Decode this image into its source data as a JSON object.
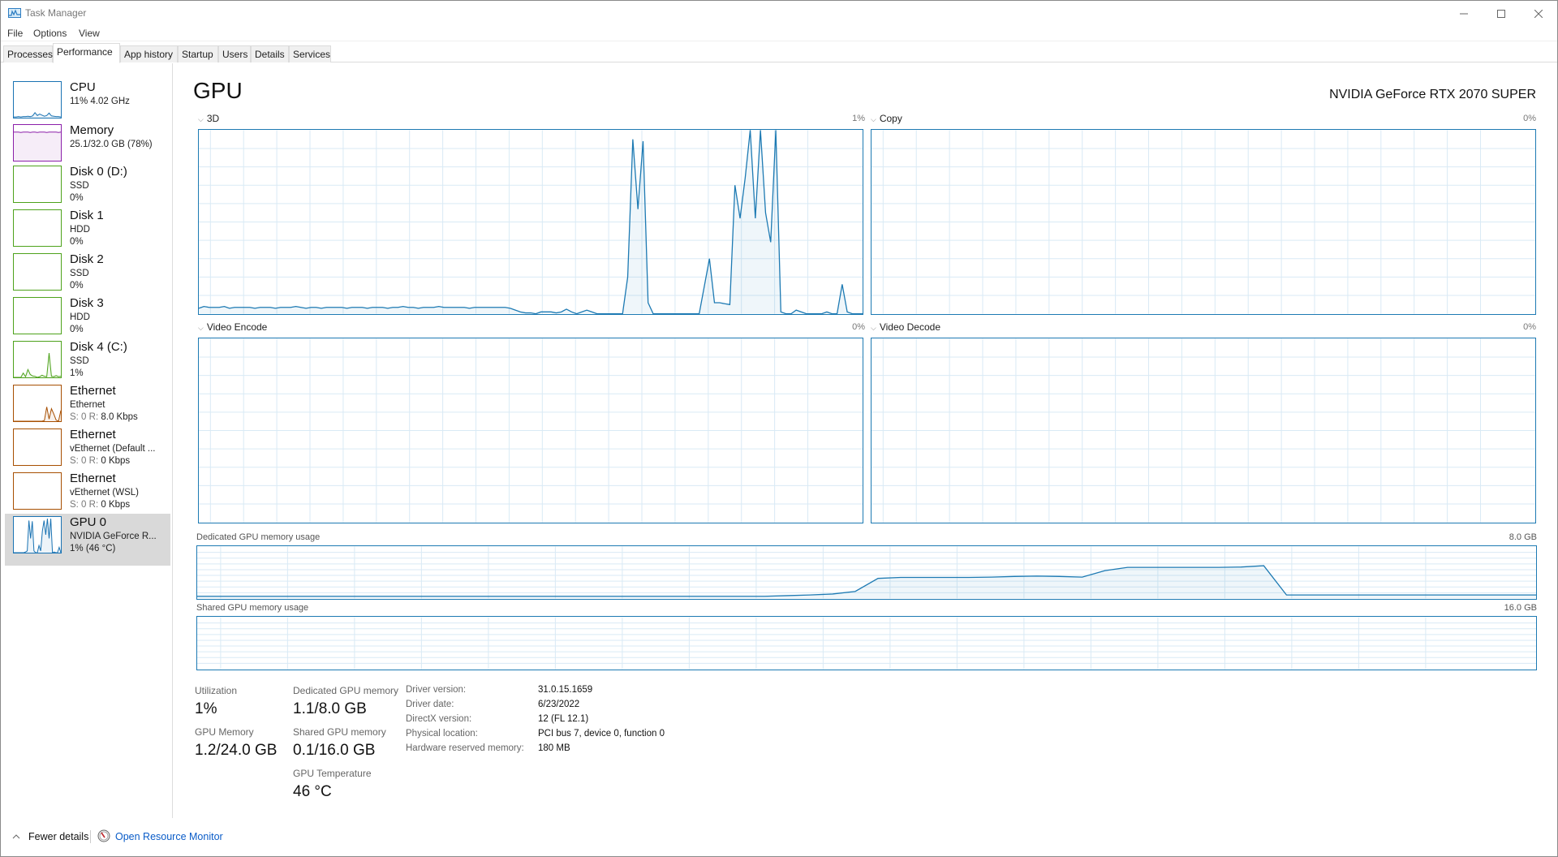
{
  "window": {
    "title": "Task Manager",
    "controls": {
      "minimize": "—",
      "maximize": "☐",
      "close": "✕"
    }
  },
  "menu": [
    "File",
    "Options",
    "View"
  ],
  "tabs": [
    {
      "label": "Processes",
      "active": false
    },
    {
      "label": "Performance",
      "active": true
    },
    {
      "label": "App history",
      "active": false
    },
    {
      "label": "Startup",
      "active": false
    },
    {
      "label": "Users",
      "active": false
    },
    {
      "label": "Details",
      "active": false
    },
    {
      "label": "Services",
      "active": false
    }
  ],
  "sidebar": {
    "items": [
      {
        "title": "CPU",
        "line1": "11% 4.02 GHz",
        "line2": "",
        "color": "#1a73b3",
        "selected": false,
        "spark": [
          2,
          2,
          3,
          2,
          3,
          3,
          4,
          3,
          5,
          14,
          6,
          10,
          7,
          4,
          6,
          13,
          5,
          4,
          3,
          3,
          2
        ]
      },
      {
        "title": "Memory",
        "line1": "25.1/32.0 GB (78%)",
        "line2": "",
        "color": "#8b1fa9",
        "selected": false,
        "spark": [
          80,
          80,
          80,
          79,
          80,
          80,
          80,
          79,
          80,
          80,
          79,
          80,
          80,
          80,
          79,
          80,
          80,
          80,
          80,
          79,
          80
        ]
      },
      {
        "title": "Disk 0 (D:)",
        "line1": "SSD",
        "line2": "0%",
        "color": "#4da21b",
        "selected": false,
        "spark": []
      },
      {
        "title": "Disk 1",
        "line1": "HDD",
        "line2": "0%",
        "color": "#4da21b",
        "selected": false,
        "spark": []
      },
      {
        "title": "Disk 2",
        "line1": "SSD",
        "line2": "0%",
        "color": "#4da21b",
        "selected": false,
        "spark": []
      },
      {
        "title": "Disk 3",
        "line1": "HDD",
        "line2": "0%",
        "color": "#4da21b",
        "selected": false,
        "spark": []
      },
      {
        "title": "Disk 4 (C:)",
        "line1": "SSD",
        "line2": "1%",
        "color": "#4da21b",
        "selected": false,
        "spark": [
          0,
          0,
          0,
          0,
          12,
          2,
          22,
          8,
          4,
          3,
          0,
          2,
          6,
          3,
          2,
          68,
          3,
          2,
          5,
          2,
          3
        ]
      },
      {
        "title": "Ethernet",
        "line1": "Ethernet",
        "line2_dim": "S: 0 R:",
        "line2": " 8.0 Kbps",
        "color": "#a74f01",
        "selected": false,
        "spark": [
          0,
          0,
          0,
          0,
          0,
          0,
          0,
          0,
          0,
          0,
          0,
          0,
          0,
          2,
          40,
          6,
          35,
          20,
          3,
          0,
          30
        ]
      },
      {
        "title": "Ethernet",
        "line1": "vEthernet (Default ...",
        "line2_dim": "S: 0 R:",
        "line2": " 0 Kbps",
        "color": "#a74f01",
        "selected": false,
        "spark": []
      },
      {
        "title": "Ethernet",
        "line1": "vEthernet (WSL)",
        "line2_dim": "S: 0 R:",
        "line2": " 0 Kbps",
        "color": "#a74f01",
        "selected": false,
        "spark": []
      },
      {
        "title": "GPU 0",
        "line1": "NVIDIA GeForce R...",
        "line2": "1%  (46 °C)",
        "color": "#1a73b3",
        "selected": true,
        "spark": [
          0,
          0,
          0,
          0,
          0,
          0,
          0,
          2,
          5,
          90,
          40,
          88,
          5,
          0,
          0,
          20,
          5,
          60,
          90,
          50,
          95,
          40,
          95,
          0,
          2,
          0,
          0,
          15,
          0
        ]
      }
    ]
  },
  "main": {
    "title": "GPU",
    "gpu_name": "NVIDIA GeForce RTX 2070 SUPER",
    "graphs": [
      {
        "label": "3D",
        "value": "1%"
      },
      {
        "label": "Copy",
        "value": "0%"
      },
      {
        "label": "Video Encode",
        "value": "0%"
      },
      {
        "label": "Video Decode",
        "value": "0%"
      }
    ],
    "dedicated": {
      "label": "Dedicated GPU memory usage",
      "max": "8.0 GB"
    },
    "shared": {
      "label": "Shared GPU memory usage",
      "max": "16.0 GB"
    },
    "stats": {
      "utilization_label": "Utilization",
      "utilization_value": "1%",
      "gpu_memory_label": "GPU Memory",
      "gpu_memory_value": "1.2/24.0 GB",
      "dedicated_label": "Dedicated GPU memory",
      "dedicated_value": "1.1/8.0 GB",
      "shared_label": "Shared GPU memory",
      "shared_value": "0.1/16.0 GB",
      "temp_label": "GPU Temperature",
      "temp_value": "46 °C"
    },
    "details": [
      {
        "label": "Driver version:",
        "value": "31.0.15.1659"
      },
      {
        "label": "Driver date:",
        "value": "6/23/2022"
      },
      {
        "label": "DirectX version:",
        "value": "12 (FL 12.1)"
      },
      {
        "label": "Physical location:",
        "value": "PCI bus 7, device 0, function 0"
      },
      {
        "label": "Hardware reserved memory:",
        "value": "180 MB"
      }
    ]
  },
  "footer": {
    "fewer_details": "Fewer details",
    "open_resource_monitor": "Open Resource Monitor"
  },
  "chart_data": [
    {
      "type": "area",
      "title": "3D",
      "ylim": [
        0,
        100
      ],
      "unit": "%",
      "grid": true,
      "values": [
        3,
        4,
        3.5,
        3.5,
        3.5,
        4,
        3,
        3.5,
        3.5,
        3.5,
        3.5,
        3,
        3.5,
        3.5,
        3.5,
        3,
        3.5,
        3.5,
        3.5,
        4,
        3.5,
        3,
        3.5,
        3.5,
        3,
        3.5,
        3.5,
        3.5,
        3.5,
        3,
        3.5,
        3.5,
        3.5,
        3,
        3.5,
        3.5,
        3.5,
        3,
        3.5,
        3.5,
        4,
        3.5,
        3.5,
        3,
        3.5,
        3.5,
        3.5,
        4,
        3.5,
        3.5,
        3.5,
        3.5,
        3.5,
        3,
        3.5,
        3.5,
        3.5,
        3.5,
        3.5,
        3.5,
        3.5,
        3,
        2,
        1,
        0.5,
        0.5,
        0,
        1,
        1,
        1,
        0.5,
        1,
        2.5,
        1,
        0,
        1,
        2,
        1,
        0,
        0,
        0,
        0,
        0,
        0,
        20,
        95,
        57,
        94,
        6,
        0,
        0,
        0,
        0,
        0,
        0,
        0,
        0,
        0,
        0,
        15,
        30,
        6,
        6,
        5.5,
        5,
        70,
        52,
        74,
        100,
        52,
        100,
        55,
        39,
        100,
        1,
        0,
        0,
        2,
        1,
        0,
        0,
        0,
        0,
        1,
        0,
        0,
        16,
        1,
        0,
        0,
        0
      ]
    },
    {
      "type": "area",
      "title": "Copy",
      "ylim": [
        0,
        100
      ],
      "unit": "%",
      "values": []
    },
    {
      "type": "area",
      "title": "Video Encode",
      "ylim": [
        0,
        100
      ],
      "unit": "%",
      "values": []
    },
    {
      "type": "area",
      "title": "Video Decode",
      "ylim": [
        0,
        100
      ],
      "unit": "%",
      "values": []
    },
    {
      "type": "area",
      "title": "Dedicated GPU memory usage",
      "ylim": [
        0,
        8.0
      ],
      "unit": "GB",
      "values": [
        0.35,
        0.35,
        0.35,
        0.35,
        0.35,
        0.35,
        0.35,
        0.35,
        0.35,
        0.35,
        0.35,
        0.35,
        0.35,
        0.35,
        0.35,
        0.35,
        0.35,
        0.35,
        0.35,
        0.35,
        0.35,
        0.35,
        0.35,
        0.35,
        0.35,
        0.35,
        0.45,
        0.55,
        0.7,
        1.1,
        3.1,
        3.25,
        3.25,
        3.25,
        3.25,
        3.3,
        3.4,
        3.45,
        3.4,
        3.3,
        4.3,
        4.8,
        4.8,
        4.8,
        4.8,
        4.8,
        4.85,
        5.05,
        0.55,
        0.55,
        0.55,
        0.55,
        0.55,
        0.55,
        0.55,
        0.55,
        0.55,
        0.55,
        0.55,
        0.55
      ]
    },
    {
      "type": "area",
      "title": "Shared GPU memory usage",
      "ylim": [
        0,
        16.0
      ],
      "unit": "GB",
      "values": []
    }
  ]
}
